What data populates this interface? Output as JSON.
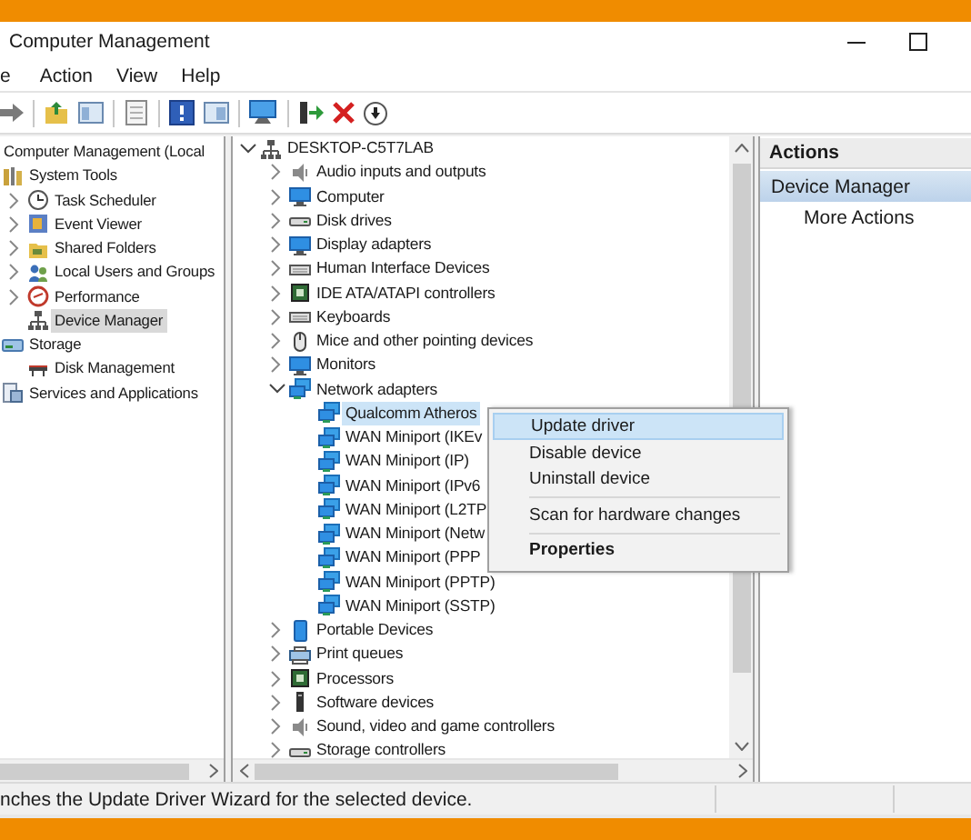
{
  "window": {
    "title": "Computer Management"
  },
  "menu": [
    "e",
    "Action",
    "View",
    "Help"
  ],
  "navigation_tree": [
    {
      "label": "Computer Management (Local",
      "selected": false,
      "children": [
        {
          "label": "System Tools",
          "kind": "tools",
          "selected": false,
          "children": [
            {
              "label": "Task Scheduler",
              "kind": "clock",
              "expanded": false,
              "selected": false
            },
            {
              "label": "Event Viewer",
              "kind": "log",
              "expanded": false,
              "selected": false
            },
            {
              "label": "Shared Folders",
              "kind": "folder",
              "expanded": false,
              "selected": false
            },
            {
              "label": "Local Users and Groups",
              "kind": "users",
              "expanded": false,
              "selected": false
            },
            {
              "label": "Performance",
              "kind": "gauge",
              "expanded": false,
              "selected": false
            },
            {
              "label": "Device Manager",
              "kind": "devices",
              "selected": true
            }
          ]
        },
        {
          "label": "Storage",
          "kind": "storage",
          "selected": false,
          "children": [
            {
              "label": "Disk Management",
              "kind": "disk",
              "selected": false
            }
          ]
        },
        {
          "label": "Services and Applications",
          "kind": "services",
          "selected": false
        }
      ]
    }
  ],
  "device_tree": [
    {
      "label": "DESKTOP-C5T7LAB",
      "kind": "devices",
      "expanded": true,
      "selected": false,
      "children": [
        {
          "label": "Audio inputs and outputs",
          "kind": "speaker",
          "expanded": false,
          "selected": false
        },
        {
          "label": "Computer",
          "kind": "monitor",
          "expanded": false,
          "selected": false
        },
        {
          "label": "Disk drives",
          "kind": "drive",
          "expanded": false,
          "selected": false
        },
        {
          "label": "Display adapters",
          "kind": "monitor",
          "expanded": false,
          "selected": false
        },
        {
          "label": "Human Interface Devices",
          "kind": "keyboard",
          "expanded": false,
          "selected": false
        },
        {
          "label": "IDE ATA/ATAPI controllers",
          "kind": "chip",
          "expanded": false,
          "selected": false
        },
        {
          "label": "Keyboards",
          "kind": "keyboard",
          "expanded": false,
          "selected": false
        },
        {
          "label": "Mice and other pointing devices",
          "kind": "mouse",
          "expanded": false,
          "selected": false
        },
        {
          "label": "Monitors",
          "kind": "monitor",
          "expanded": false,
          "selected": false
        },
        {
          "label": "Network adapters",
          "kind": "network",
          "expanded": true,
          "selected": false,
          "children": [
            {
              "label": "Qualcomm Atheros",
              "kind": "network",
              "selected": true
            },
            {
              "label": "WAN Miniport (IKEv",
              "kind": "network",
              "selected": false
            },
            {
              "label": "WAN Miniport (IP)",
              "kind": "network",
              "selected": false
            },
            {
              "label": "WAN Miniport (IPv6",
              "kind": "network",
              "selected": false
            },
            {
              "label": "WAN Miniport (L2TP",
              "kind": "network",
              "selected": false
            },
            {
              "label": "WAN Miniport (Netw",
              "kind": "network",
              "selected": false
            },
            {
              "label": "WAN Miniport (PPP",
              "kind": "network",
              "selected": false
            },
            {
              "label": "WAN Miniport (PPTP)",
              "kind": "network",
              "selected": false
            },
            {
              "label": "WAN Miniport (SSTP)",
              "kind": "network",
              "selected": false
            }
          ]
        },
        {
          "label": "Portable Devices",
          "kind": "portable",
          "expanded": false,
          "selected": false
        },
        {
          "label": "Print queues",
          "kind": "printer",
          "expanded": false,
          "selected": false
        },
        {
          "label": "Processors",
          "kind": "chip",
          "expanded": false,
          "selected": false
        },
        {
          "label": "Software devices",
          "kind": "tower",
          "expanded": false,
          "selected": false
        },
        {
          "label": "Sound, video and game controllers",
          "kind": "speaker",
          "expanded": false,
          "selected": false
        },
        {
          "label": "Storage controllers",
          "kind": "drive",
          "expanded": false,
          "selected": false
        }
      ]
    }
  ],
  "context_menu": [
    {
      "kind": "item",
      "label": "Update driver",
      "selected": true,
      "default": false
    },
    {
      "kind": "item",
      "label": "Disable device",
      "selected": false,
      "default": false
    },
    {
      "kind": "item",
      "label": "Uninstall device",
      "selected": false,
      "default": false
    },
    {
      "kind": "separator"
    },
    {
      "kind": "item",
      "label": "Scan for hardware changes",
      "selected": false,
      "default": false
    },
    {
      "kind": "separator"
    },
    {
      "kind": "item",
      "label": "Properties",
      "selected": false,
      "default": true
    }
  ],
  "actions": {
    "header": "Actions",
    "section": "Device Manager",
    "items": [
      "More Actions"
    ]
  },
  "status_bar": {
    "text": "nches the Update Driver Wizard for the selected device."
  }
}
